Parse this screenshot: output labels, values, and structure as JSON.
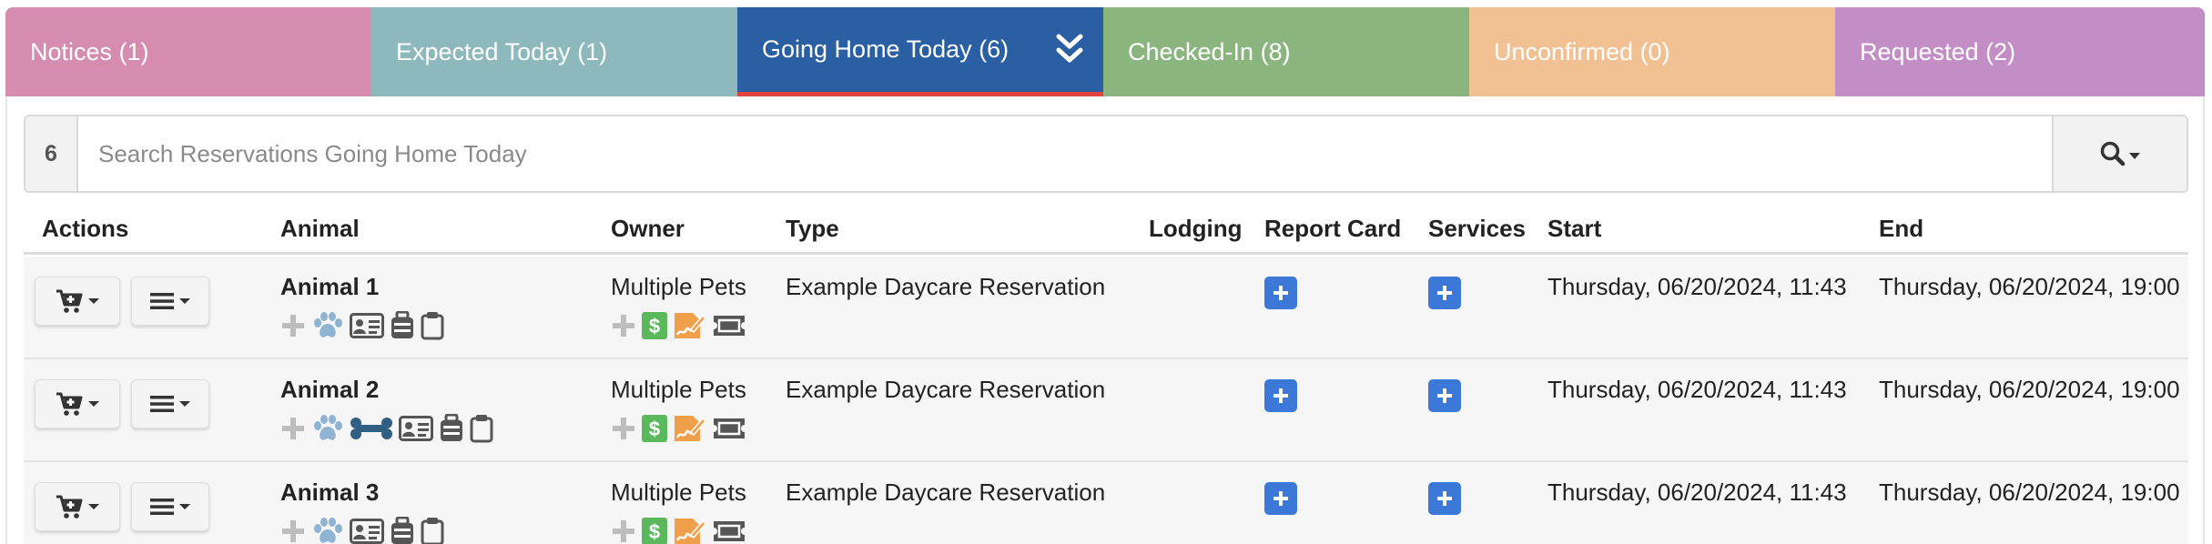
{
  "tabs": [
    {
      "label": "Notices (1)",
      "color": "#d58cae"
    },
    {
      "label": "Expected Today (1)",
      "color": "#8db8bc"
    },
    {
      "label": "Going Home Today (6)",
      "color": "#2a5fa3",
      "active": true
    },
    {
      "label": "Checked-In (8)",
      "color": "#8ab57f"
    },
    {
      "label": "Unconfirmed (0)",
      "color": "#f1c194"
    },
    {
      "label": "Requested (2)",
      "color": "#c38dc6"
    }
  ],
  "search": {
    "count": "6",
    "placeholder": "Search Reservations Going Home Today"
  },
  "columns": {
    "actions": "Actions",
    "animal": "Animal",
    "owner": "Owner",
    "type": "Type",
    "lodging": "Lodging",
    "report_card": "Report Card",
    "services": "Services",
    "start": "Start",
    "end": "End"
  },
  "rows": [
    {
      "animal": "Animal 1",
      "owner": "Multiple Pets",
      "type": "Example Daycare Reservation",
      "lodging": "",
      "start": "Thursday, 06/20/2024, 11:43",
      "end": "Thursday, 06/20/2024, 19:00",
      "animal_icons": [
        "plus-icon",
        "paw-icon",
        "id-card-icon",
        "suitcase-icon",
        "clipboard-icon"
      ]
    },
    {
      "animal": "Animal 2",
      "owner": "Multiple Pets",
      "type": "Example Daycare Reservation",
      "lodging": "",
      "start": "Thursday, 06/20/2024, 11:43",
      "end": "Thursday, 06/20/2024, 19:00",
      "animal_icons": [
        "plus-icon",
        "paw-icon",
        "bone-icon",
        "id-card-icon",
        "suitcase-icon",
        "clipboard-icon"
      ]
    },
    {
      "animal": "Animal 3",
      "owner": "Multiple Pets",
      "type": "Example Daycare Reservation",
      "lodging": "",
      "start": "Thursday, 06/20/2024, 11:43",
      "end": "Thursday, 06/20/2024, 19:00",
      "animal_icons": [
        "plus-icon",
        "paw-icon",
        "id-card-icon",
        "suitcase-icon",
        "clipboard-icon"
      ]
    }
  ],
  "owner_icons": [
    "plus-icon",
    "dollar-icon",
    "signature-icon",
    "ticket-icon"
  ],
  "colors": {
    "active_tab_underline": "#e0433d",
    "add_button": "#3b78d8",
    "dollar_badge": "#5cb85c",
    "signature_badge": "#f0a04b",
    "icon_gray": "#555555",
    "icon_light": "#bdbdbd",
    "paw_blue": "#8fb3d3",
    "bone_blue": "#2f5f83"
  }
}
